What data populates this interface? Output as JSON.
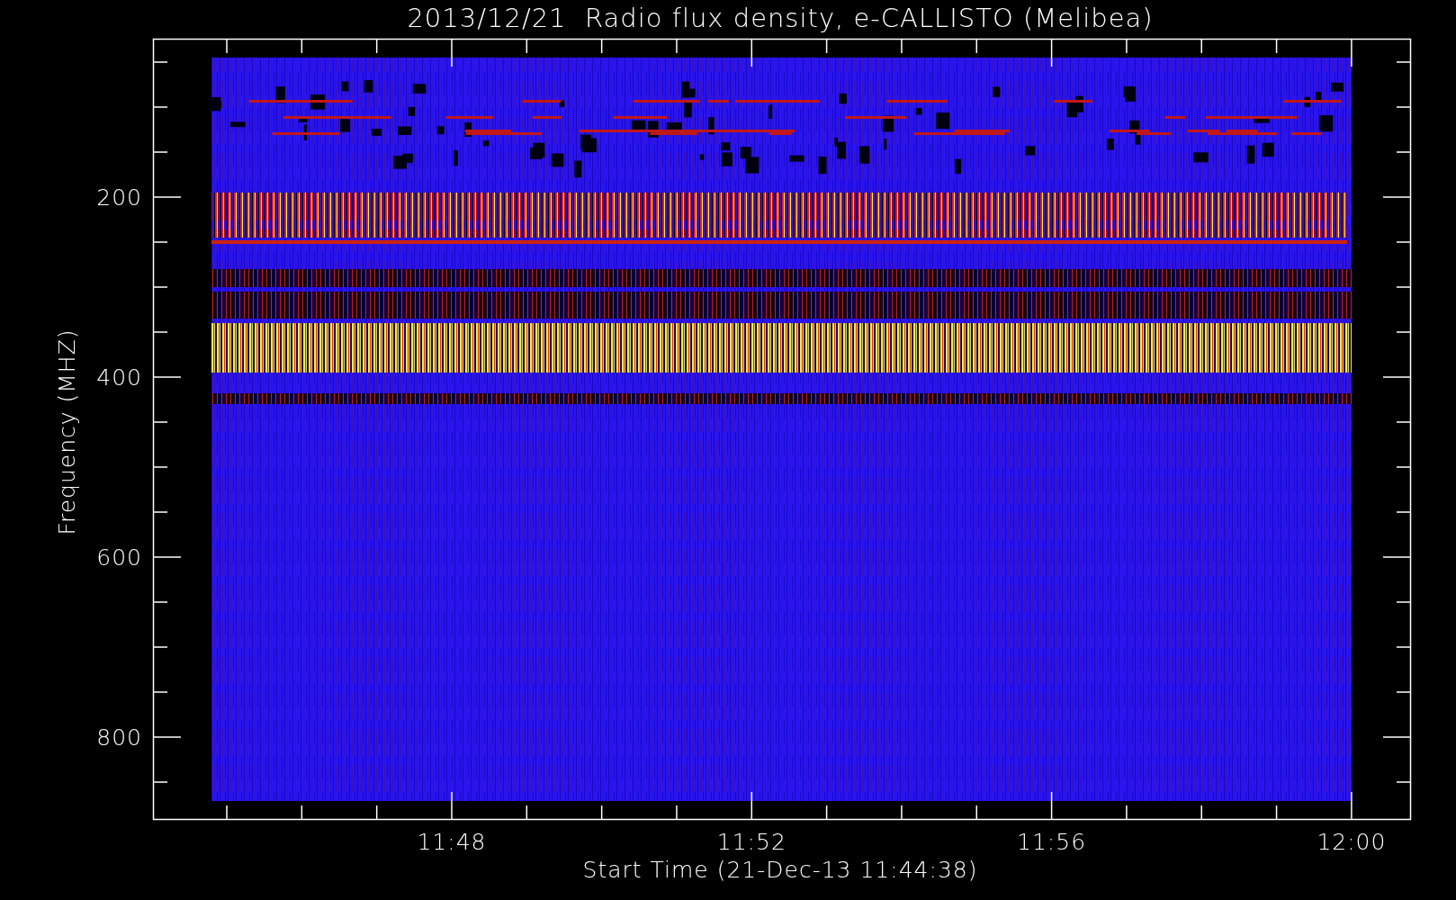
{
  "plot": {
    "title": "2013/12/21  Radio flux density, e-CALLISTO (Melibea)",
    "ylabel": "Frequency (MHZ)",
    "xlabel": "Start Time (21-Dec-13 11:44:38)",
    "yticks": [
      "200",
      "400",
      "600",
      "800"
    ],
    "xticks": [
      "11:48",
      "11:52",
      "11:56",
      "12:00"
    ]
  }
}
